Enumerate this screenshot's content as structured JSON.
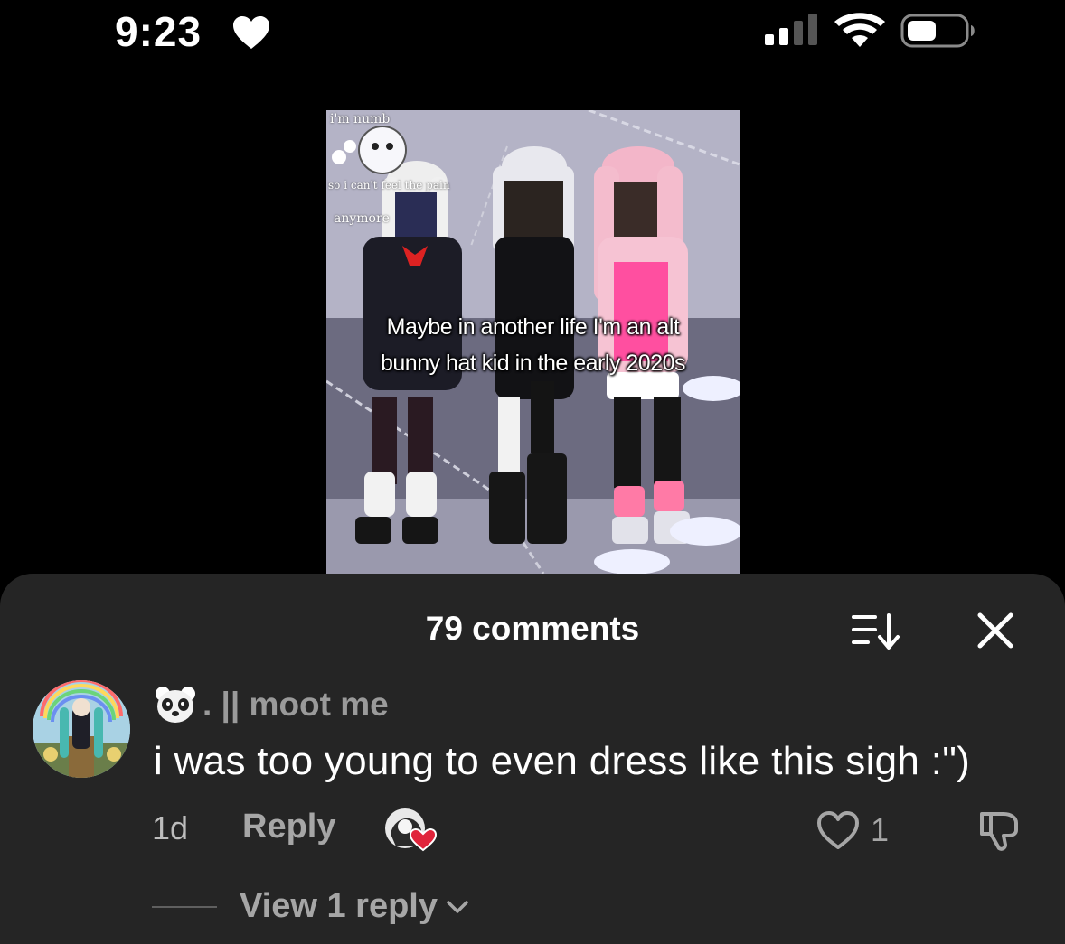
{
  "status_bar": {
    "time": "9:23",
    "status_icon": "heart-icon",
    "signal_icon": "cellular-signal-icon",
    "wifi_icon": "wifi-icon",
    "battery_icon": "battery-icon"
  },
  "video": {
    "overlay_caption_line1": "Maybe in another life I'm an alt",
    "overlay_caption_line2": "bunny hat kid in the early 2020s",
    "sticker_text_1": "i'm numb",
    "sticker_text_2": "so i can't feel the pain",
    "sticker_text_3": "anymore"
  },
  "comments_sheet": {
    "title": "79 comments",
    "sort_icon": "sort-icon",
    "close_icon": "close-icon",
    "comments": [
      {
        "username": ". || moot me",
        "username_emoji": "panda-icon",
        "text": "i was too young to even dress like this sigh :\")",
        "time": "1d",
        "reply_label": "Reply",
        "like_count": "1",
        "view_replies_label": "View 1 reply"
      }
    ]
  },
  "colors": {
    "background": "#000000",
    "sheet": "#252525",
    "muted_text": "#a6a6a6",
    "like_red": "#e0243b"
  }
}
